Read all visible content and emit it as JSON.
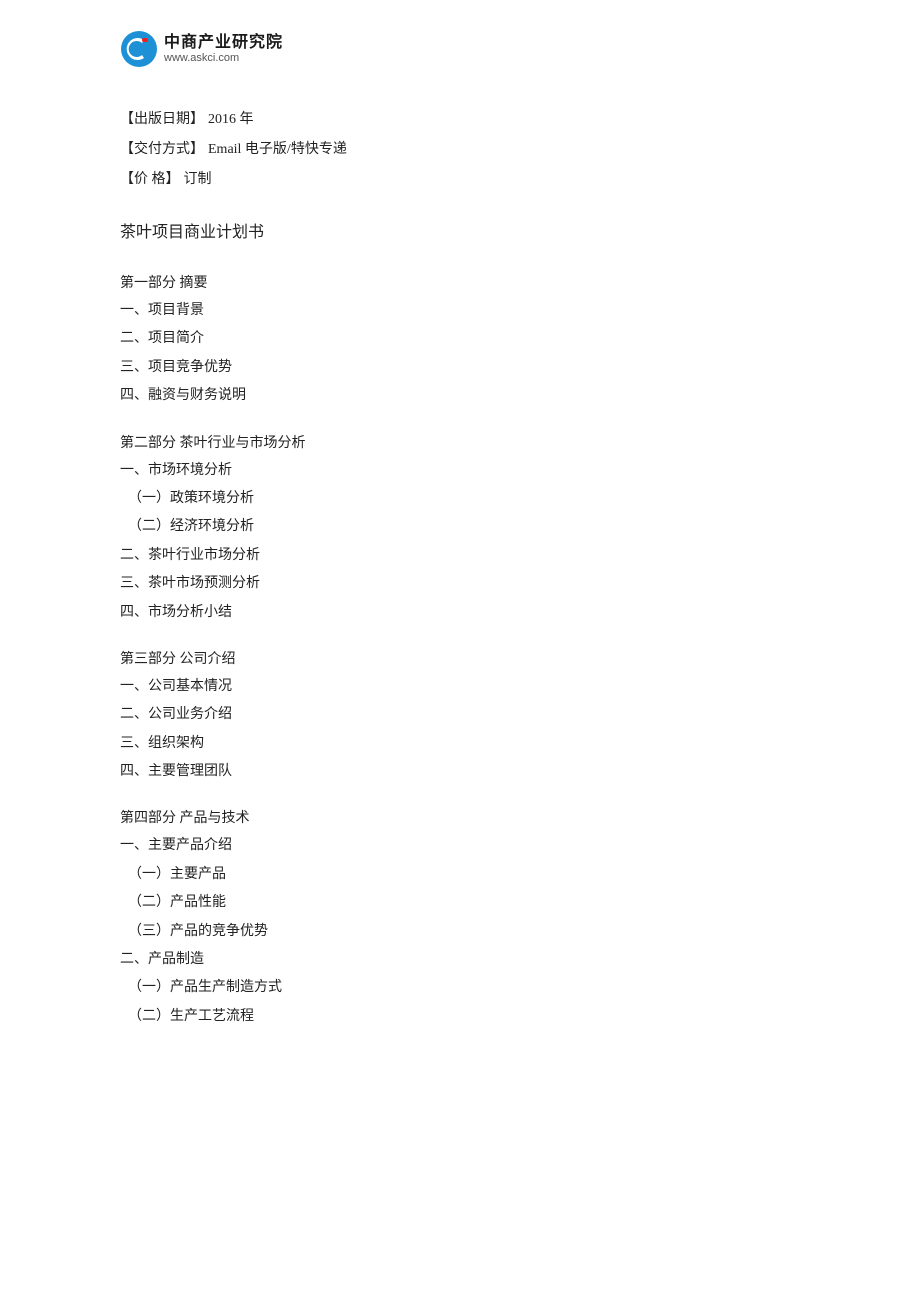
{
  "logo": {
    "main_text": "中商产业研究院",
    "sub_text": "www.askci.com"
  },
  "meta": {
    "publish_date_label": "【出版日期】",
    "publish_date_value": "2016 年",
    "delivery_label": "【交付方式】",
    "delivery_value": "Email 电子版/特快专递",
    "price_label": "【价        格】",
    "price_value": "订制"
  },
  "doc_title": "茶叶项目商业计划书",
  "toc": [
    {
      "part": "第一部分  摘要",
      "items": [
        {
          "text": "一、项目背景",
          "level": 1
        },
        {
          "text": "二、项目简介",
          "level": 1
        },
        {
          "text": "三、项目竞争优势",
          "level": 1
        },
        {
          "text": "四、融资与财务说明",
          "level": 1
        }
      ]
    },
    {
      "part": "第二部分  茶叶行业与市场分析",
      "items": [
        {
          "text": "一、市场环境分析",
          "level": 1
        },
        {
          "text": "（一）政策环境分析",
          "level": 2
        },
        {
          "text": "（二）经济环境分析",
          "level": 2
        },
        {
          "text": "二、茶叶行业市场分析",
          "level": 1
        },
        {
          "text": "三、茶叶市场预测分析",
          "level": 1
        },
        {
          "text": "四、市场分析小结",
          "level": 1
        }
      ]
    },
    {
      "part": "第三部分  公司介绍",
      "items": [
        {
          "text": "一、公司基本情况",
          "level": 1
        },
        {
          "text": "二、公司业务介绍",
          "level": 1
        },
        {
          "text": "三、组织架构",
          "level": 1
        },
        {
          "text": "四、主要管理团队",
          "level": 1
        }
      ]
    },
    {
      "part": "第四部分  产品与技术",
      "items": [
        {
          "text": "一、主要产品介绍",
          "level": 1
        },
        {
          "text": "（一）主要产品",
          "level": 2
        },
        {
          "text": "（二）产品性能",
          "level": 2
        },
        {
          "text": "（三）产品的竞争优势",
          "level": 2
        },
        {
          "text": "二、产品制造",
          "level": 1
        },
        {
          "text": "（一）产品生产制造方式",
          "level": 2
        },
        {
          "text": "（二）生产工艺流程",
          "level": 2
        }
      ]
    }
  ]
}
